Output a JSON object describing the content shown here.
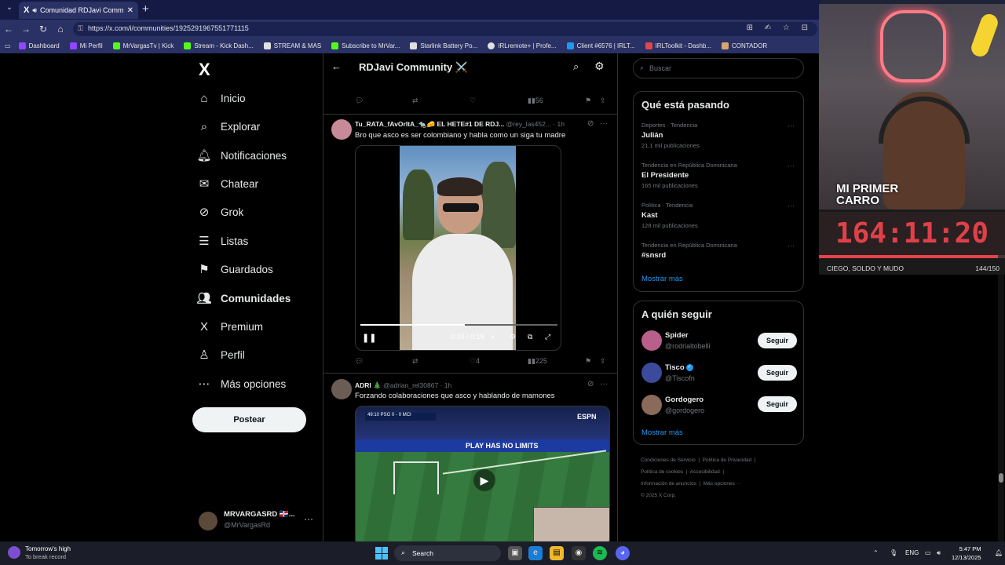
{
  "browser": {
    "tab_title": "Comunidad RDJavi Communi",
    "url": "https://x.com/i/communities/1925291967551771115",
    "bookmarks": [
      {
        "label": "Dashboard",
        "color": "#9146ff"
      },
      {
        "label": "Mi Perfil",
        "color": "#9146ff"
      },
      {
        "label": "MrVargasTv | Kick",
        "color": "#53fc18"
      },
      {
        "label": "Stream - Kick Dash...",
        "color": "#53fc18"
      },
      {
        "label": "STREAM & MAS",
        "color": "#e0e0e0"
      },
      {
        "label": "Subscribe to MrVar...",
        "color": "#53fc18"
      },
      {
        "label": "Starlink Battery Po...",
        "color": "#e0e0e0"
      },
      {
        "label": "IRLremote+ | Profe...",
        "color": "#e0e0e0"
      },
      {
        "label": "Client #6576 | IRLT...",
        "color": "#1d9bf0"
      },
      {
        "label": "IRLToolkit - Dashb...",
        "color": "#e0464e"
      },
      {
        "label": "CONTADOR",
        "color": "#d7a86e"
      }
    ]
  },
  "nav": {
    "items": [
      {
        "label": "Inicio",
        "icon": "⌂"
      },
      {
        "label": "Explorar",
        "icon": "⌕"
      },
      {
        "label": "Notificaciones",
        "icon": "🔔︎"
      },
      {
        "label": "Chatear",
        "icon": "✉"
      },
      {
        "label": "Grok",
        "icon": "⊘"
      },
      {
        "label": "Listas",
        "icon": "☰"
      },
      {
        "label": "Guardados",
        "icon": "⚑"
      },
      {
        "label": "Comunidades",
        "icon": "👥︎"
      },
      {
        "label": "Premium",
        "icon": "X"
      },
      {
        "label": "Perfil",
        "icon": "♙"
      },
      {
        "label": "Más opciones",
        "icon": "⋯"
      }
    ],
    "post_button": "Postear",
    "account_name": "MRVARGASRD 🇩🇴...",
    "account_handle": "@MrVargasRd"
  },
  "feed": {
    "title": "RDJavi Community ⚔️",
    "prev_post_views": "56",
    "post1": {
      "name": "Tu_RATA_fAvOrItA_🐀🧀 EL HETE#1 DE RDJ...",
      "handle": "@rey_las452...",
      "time": "· 1h",
      "text": "Bro que asco es ser colombiano y habla como un siga tu madre",
      "video_time": "0:10 / 0:19",
      "video_progress": 0.53,
      "likes": "4",
      "views": "225"
    },
    "post2": {
      "name": "ADRI 🎄",
      "handle": "@adrian_rel30867",
      "time": "· 1h",
      "text": "Forzando colaboraciones que asco y hablando de mamones",
      "score": "49:10  PSG  0 - 0  MCI",
      "brand": "ESPN",
      "board": "PLAY HAS NO LIMITS"
    }
  },
  "sidebar": {
    "search_placeholder": "Buscar",
    "trends_title": "Qué está pasando",
    "trends": [
      {
        "context": "Deportes · Tendencia",
        "name": "Julián",
        "count": "21,1 mil publicaciones"
      },
      {
        "context": "Tendencia en República Dominicana",
        "name": "El Presidente",
        "count": "165 mil publicaciones"
      },
      {
        "context": "Política · Tendencia",
        "name": "Kast",
        "count": "128 mil publicaciones"
      },
      {
        "context": "Tendencia en República Dominicana",
        "name": "#snsrd",
        "count": ""
      }
    ],
    "show_more": "Mostrar más",
    "who_title": "A quién seguir",
    "who": [
      {
        "name": "Spider",
        "handle": "@rodrialtobelli",
        "verified": false
      },
      {
        "name": "Tisco",
        "handle": "@Tiscofn",
        "verified": true
      },
      {
        "name": "Gordogero",
        "handle": "@gordogero",
        "verified": false
      }
    ],
    "follow_label": "Seguir",
    "footer": {
      "l1": "Condiciones de Servicio",
      "l2": "Política de Privacidad",
      "l3": "Política de cookies",
      "l4": "Accesibilidad",
      "l5": "Información de anuncios",
      "l6": "Más opciones ···",
      "l7": "© 2025 X Corp."
    }
  },
  "overlay": {
    "car_line1": "MI PRIMER",
    "car_line2": "CARRO",
    "timer": "164:11:20",
    "timer_progress": 0.96,
    "footer_left": "CIEGO, SOLDO Y MUDO",
    "footer_right": "144/150"
  },
  "taskbar": {
    "weather_title": "Tomorrow's high",
    "weather_sub": "To break record",
    "search_label": "Search",
    "lang": "ENG",
    "time": "5:47 PM",
    "date": "12/13/2025"
  }
}
